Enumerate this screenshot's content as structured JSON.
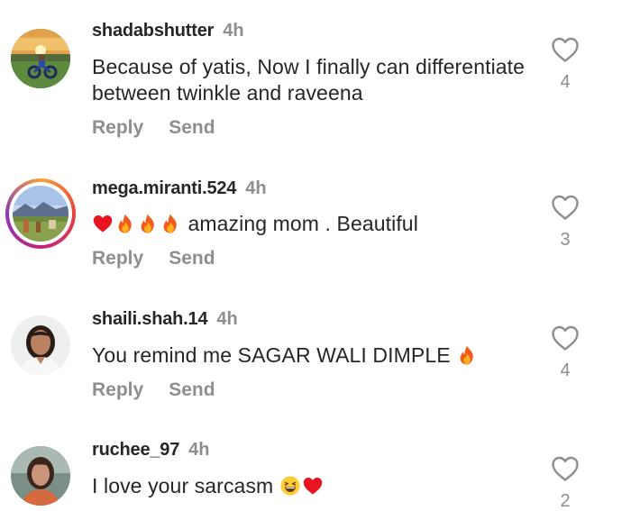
{
  "comments": [
    {
      "username": "shadabshutter",
      "time": "4h",
      "text": "Because of yatis, Now I finally can differentiate between twinkle and raveena",
      "reply_label": "Reply",
      "send_label": "Send",
      "likes": "4",
      "avatar_story_ring": false
    },
    {
      "username": "mega.miranti.524",
      "time": "4h",
      "emojis": [
        "red-heart",
        "fire",
        "fire",
        "fire"
      ],
      "text": "amazing mom . Beautiful",
      "reply_label": "Reply",
      "send_label": "Send",
      "likes": "3",
      "avatar_story_ring": true
    },
    {
      "username": "shaili.shah.14",
      "time": "4h",
      "text": "You remind me SAGAR WALI DIMPLE",
      "trailing_emojis": [
        "fire"
      ],
      "reply_label": "Reply",
      "send_label": "Send",
      "likes": "4",
      "avatar_story_ring": false
    },
    {
      "username": "ruchee_97",
      "time": "4h",
      "text": "I love your sarcasm",
      "trailing_emojis": [
        "grinning-squinting-face",
        "red-heart"
      ],
      "likes": "2",
      "avatar_story_ring": false
    }
  ],
  "colors": {
    "text_primary": "#262626",
    "text_secondary": "#8e8e8e",
    "story_ring": [
      "#f6a23a",
      "#e8413c",
      "#c2227c",
      "#8a3ab9"
    ]
  },
  "icons": {
    "like": "heart-outline-icon",
    "fire": "fire-emoji",
    "heart": "red-heart-emoji",
    "laugh": "grinning-squinting-face-emoji"
  }
}
